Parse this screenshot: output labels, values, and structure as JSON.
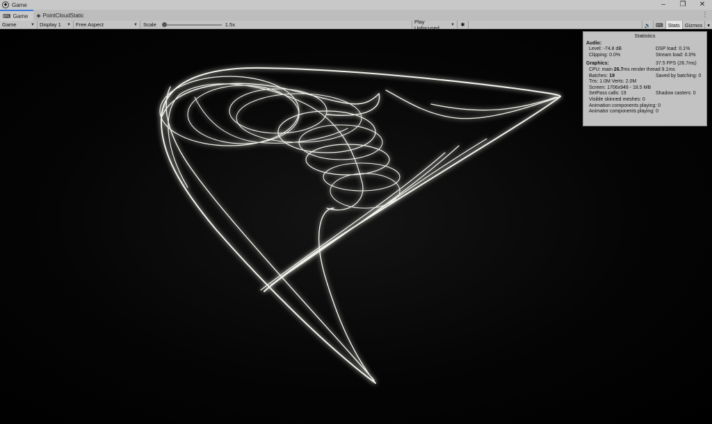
{
  "window": {
    "title": "Game"
  },
  "tabs": [
    {
      "label": "Game",
      "icon": "gamepad-icon",
      "active": true
    },
    {
      "label": "PointCloudStatic",
      "icon": "unity-icon",
      "active": false
    }
  ],
  "toolbar": {
    "view": "Game",
    "display": "Display 1",
    "aspect": "Free Aspect",
    "scale_label": "Scale",
    "scale_value": "1.5x",
    "play_mode": "Play Unfocused",
    "stats_label": "Stats",
    "gizmos_label": "Gizmos"
  },
  "stats": {
    "title": "Statistics",
    "audio_header": "Audio:",
    "level": "Level: -74.8 dB",
    "dsp": "DSP load: 0.1%",
    "clipping": "Clipping: 0.0%",
    "stream": "Stream load: 0.0%",
    "graphics_header": "Graphics:",
    "fps": "37.5 FPS (26.7ms)",
    "cpu_prefix": "CPU: main",
    "cpu_main": "26.7",
    "cpu_suffix": "ms  render thread 9.1ms",
    "batches_prefix": "Batches:",
    "batches": "19",
    "saved_batching": "Saved by batching: 0",
    "tris": "Tris: 1.0M  Verts: 2.0M",
    "screen": "Screen: 1706x949 - 18.5 MB",
    "setpass": "SetPass calls: 19",
    "shadow": "Shadow casters: 0",
    "skinned": "Visible skinned meshes: 0",
    "animation": "Animation components playing: 0",
    "animator": "Animator components playing: 0"
  }
}
